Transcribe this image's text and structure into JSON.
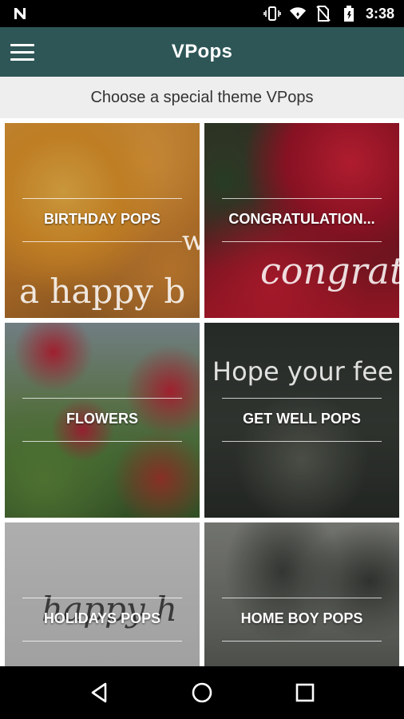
{
  "status_bar": {
    "time": "3:38",
    "icons": [
      "n-notification-icon",
      "vibrate-icon",
      "wifi-icon",
      "no-sim-icon",
      "battery-icon"
    ]
  },
  "app_bar": {
    "title": "VPops",
    "menu_icon": "hamburger-menu-icon",
    "color": "#2e5656"
  },
  "subheader": {
    "text": "Choose a special theme VPops"
  },
  "tiles": [
    {
      "label": "BIRTHDAY POPS",
      "script_text": "a happy b",
      "script_text_2": "w"
    },
    {
      "label": "CONGRATULATION...",
      "script_text": "congratu"
    },
    {
      "label": "FLOWERS"
    },
    {
      "label": "GET WELL POPS",
      "script_text": "Hope your fee"
    },
    {
      "label": "HOLIDAYS POPS",
      "script_text": "happy h"
    },
    {
      "label": "HOME BOY POPS"
    }
  ],
  "nav_bar": {
    "icons": [
      "back-triangle-icon",
      "home-circle-icon",
      "recents-square-icon"
    ]
  }
}
